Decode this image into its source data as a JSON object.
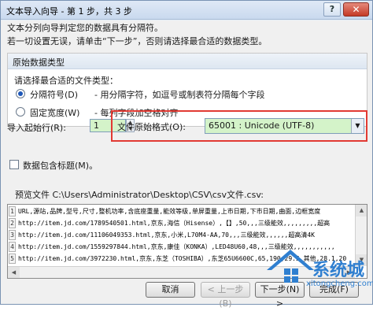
{
  "window": {
    "title": "文本导入向导 - 第 1 步，共 3 步",
    "help": "?",
    "close": "✕"
  },
  "intro": {
    "line1": "文本分列向导判定您的数据具有分隔符。",
    "line2": "若一切设置无误，请单击“下一步”，否则请选择最合适的数据类型。"
  },
  "data_type": {
    "group_title": "原始数据类型",
    "prompt": "请选择最合适的文件类型：",
    "options": [
      {
        "label": "分隔符号(D)",
        "desc": "- 用分隔字符，如逗号或制表符分隔每个字段",
        "selected": true
      },
      {
        "label": "固定宽度(W)",
        "desc": "- 每列字段加空格对齐",
        "selected": false
      }
    ]
  },
  "start_row": {
    "label": "导入起始行(R):",
    "value": "1"
  },
  "file_origin": {
    "label": "文件原始格式(O):",
    "value": "65001 : Unicode (UTF-8)"
  },
  "has_headers": {
    "label": "数据包含标题(M)。",
    "checked": false
  },
  "preview": {
    "label": "预览文件 C:\\Users\\Administrator\\Desktop\\CSV\\csv文件.csv:",
    "rows": [
      {
        "num": "1",
        "text": "URL,源站,品牌,型号,尺寸,整机功率,含底座重量,能效等级,单屏重量,上市日期,下市日期,曲面,边框宽度"
      },
      {
        "num": "2",
        "text": "http://item.jd.com/1789540501.html,京东,海信（Hisense）,【】,50,,,三级能效,,,,,,,,,超高"
      },
      {
        "num": "3",
        "text": "http://item.jd.com/11106049353.html,京东,小米,L70M4-AA,70,,,三级能效,,,,,,超高清4K"
      },
      {
        "num": "4",
        "text": "http://item.jd.com/1559297844.html,京东,康佳（KONKA）,LED48U60,48,,,三级能效,,,,,,,,,,,"
      },
      {
        "num": "5",
        "text": "http://item.jd.com/3972230.html,京东,东芝（TOSHIBA）,东芝65U6600C,65,190,29.5,其他,28.1,20"
      }
    ]
  },
  "buttons": {
    "cancel": "取消",
    "back": "< 上一步(B)",
    "next": "下一步(N) >",
    "finish": "完成(F)"
  },
  "watermark": {
    "brand": "系统城",
    "url": "xitongcheng.com"
  },
  "colors": {
    "highlight": "#e23a33",
    "field_bg": "#d4f3c9",
    "accent": "#1d57b8"
  }
}
